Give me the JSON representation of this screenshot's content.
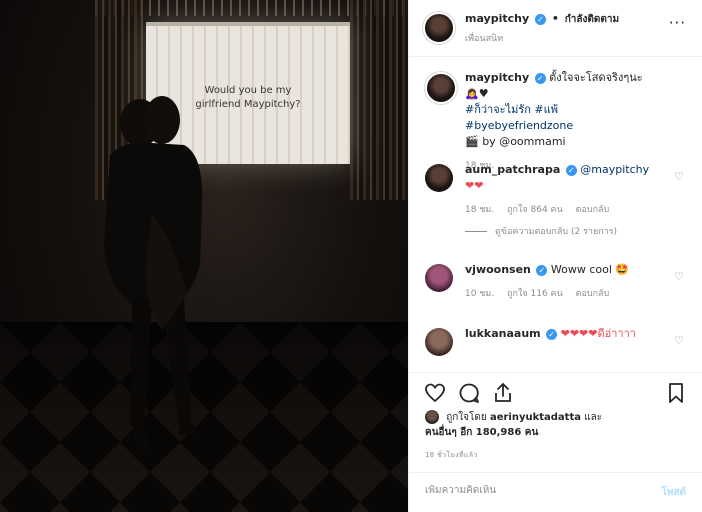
{
  "photo": {
    "screen_text": "Would you be my girlfriend Maypitchy?"
  },
  "header": {
    "username": "maypitchy",
    "separator": "•",
    "follow_status": "กำลังติดตาม",
    "subtitle": "เพื่อนสนิท",
    "more": "···"
  },
  "caption": {
    "username": "maypitchy",
    "text": "ตั้งใจจะโสดจริงๆนะ🙇‍♀️♥",
    "hashtags": "#ก็ว่าจะไม่รัก #แพ้ #byebyefriendzone",
    "credit_icon": "🎬",
    "credit_text": "by @oommami",
    "time": "18 ชม."
  },
  "comments": [
    {
      "username": "aum_patchrapa",
      "text": "@maypitchy",
      "text2": "❤❤",
      "time": "18 ชม.",
      "likes": "ถูกใจ 864 คน",
      "reply": "ตอบกลับ",
      "view_replies": "ดูข้อความตอบกลับ (2 รายการ)"
    },
    {
      "username": "vjwoonsen",
      "text": "Woww cool 🤩",
      "time": "10 ชม.",
      "likes": "ถูกใจ 116 คน",
      "reply": "ตอบกลับ"
    },
    {
      "username": "lukkanaaum",
      "text": "❤❤❤❤ดีอ่าาาา"
    }
  ],
  "likes": {
    "liked_by_prefix": "ถูกใจโดย",
    "liked_by_user": "aerinyuktadatta",
    "and": "และ",
    "others": "คนอื่นๆ อีก 180,986 คน"
  },
  "timestamp": "18 ชั่วโมงที่แล้ว",
  "add_comment": {
    "placeholder": "เพิ่มความคิดเห็น",
    "post_label": "โพสต์"
  },
  "colors": {
    "verified": "#3897f0",
    "heart": "#ed4956",
    "post_disabled": "#b2dffc",
    "meta_gray": "#8e8e8e"
  }
}
